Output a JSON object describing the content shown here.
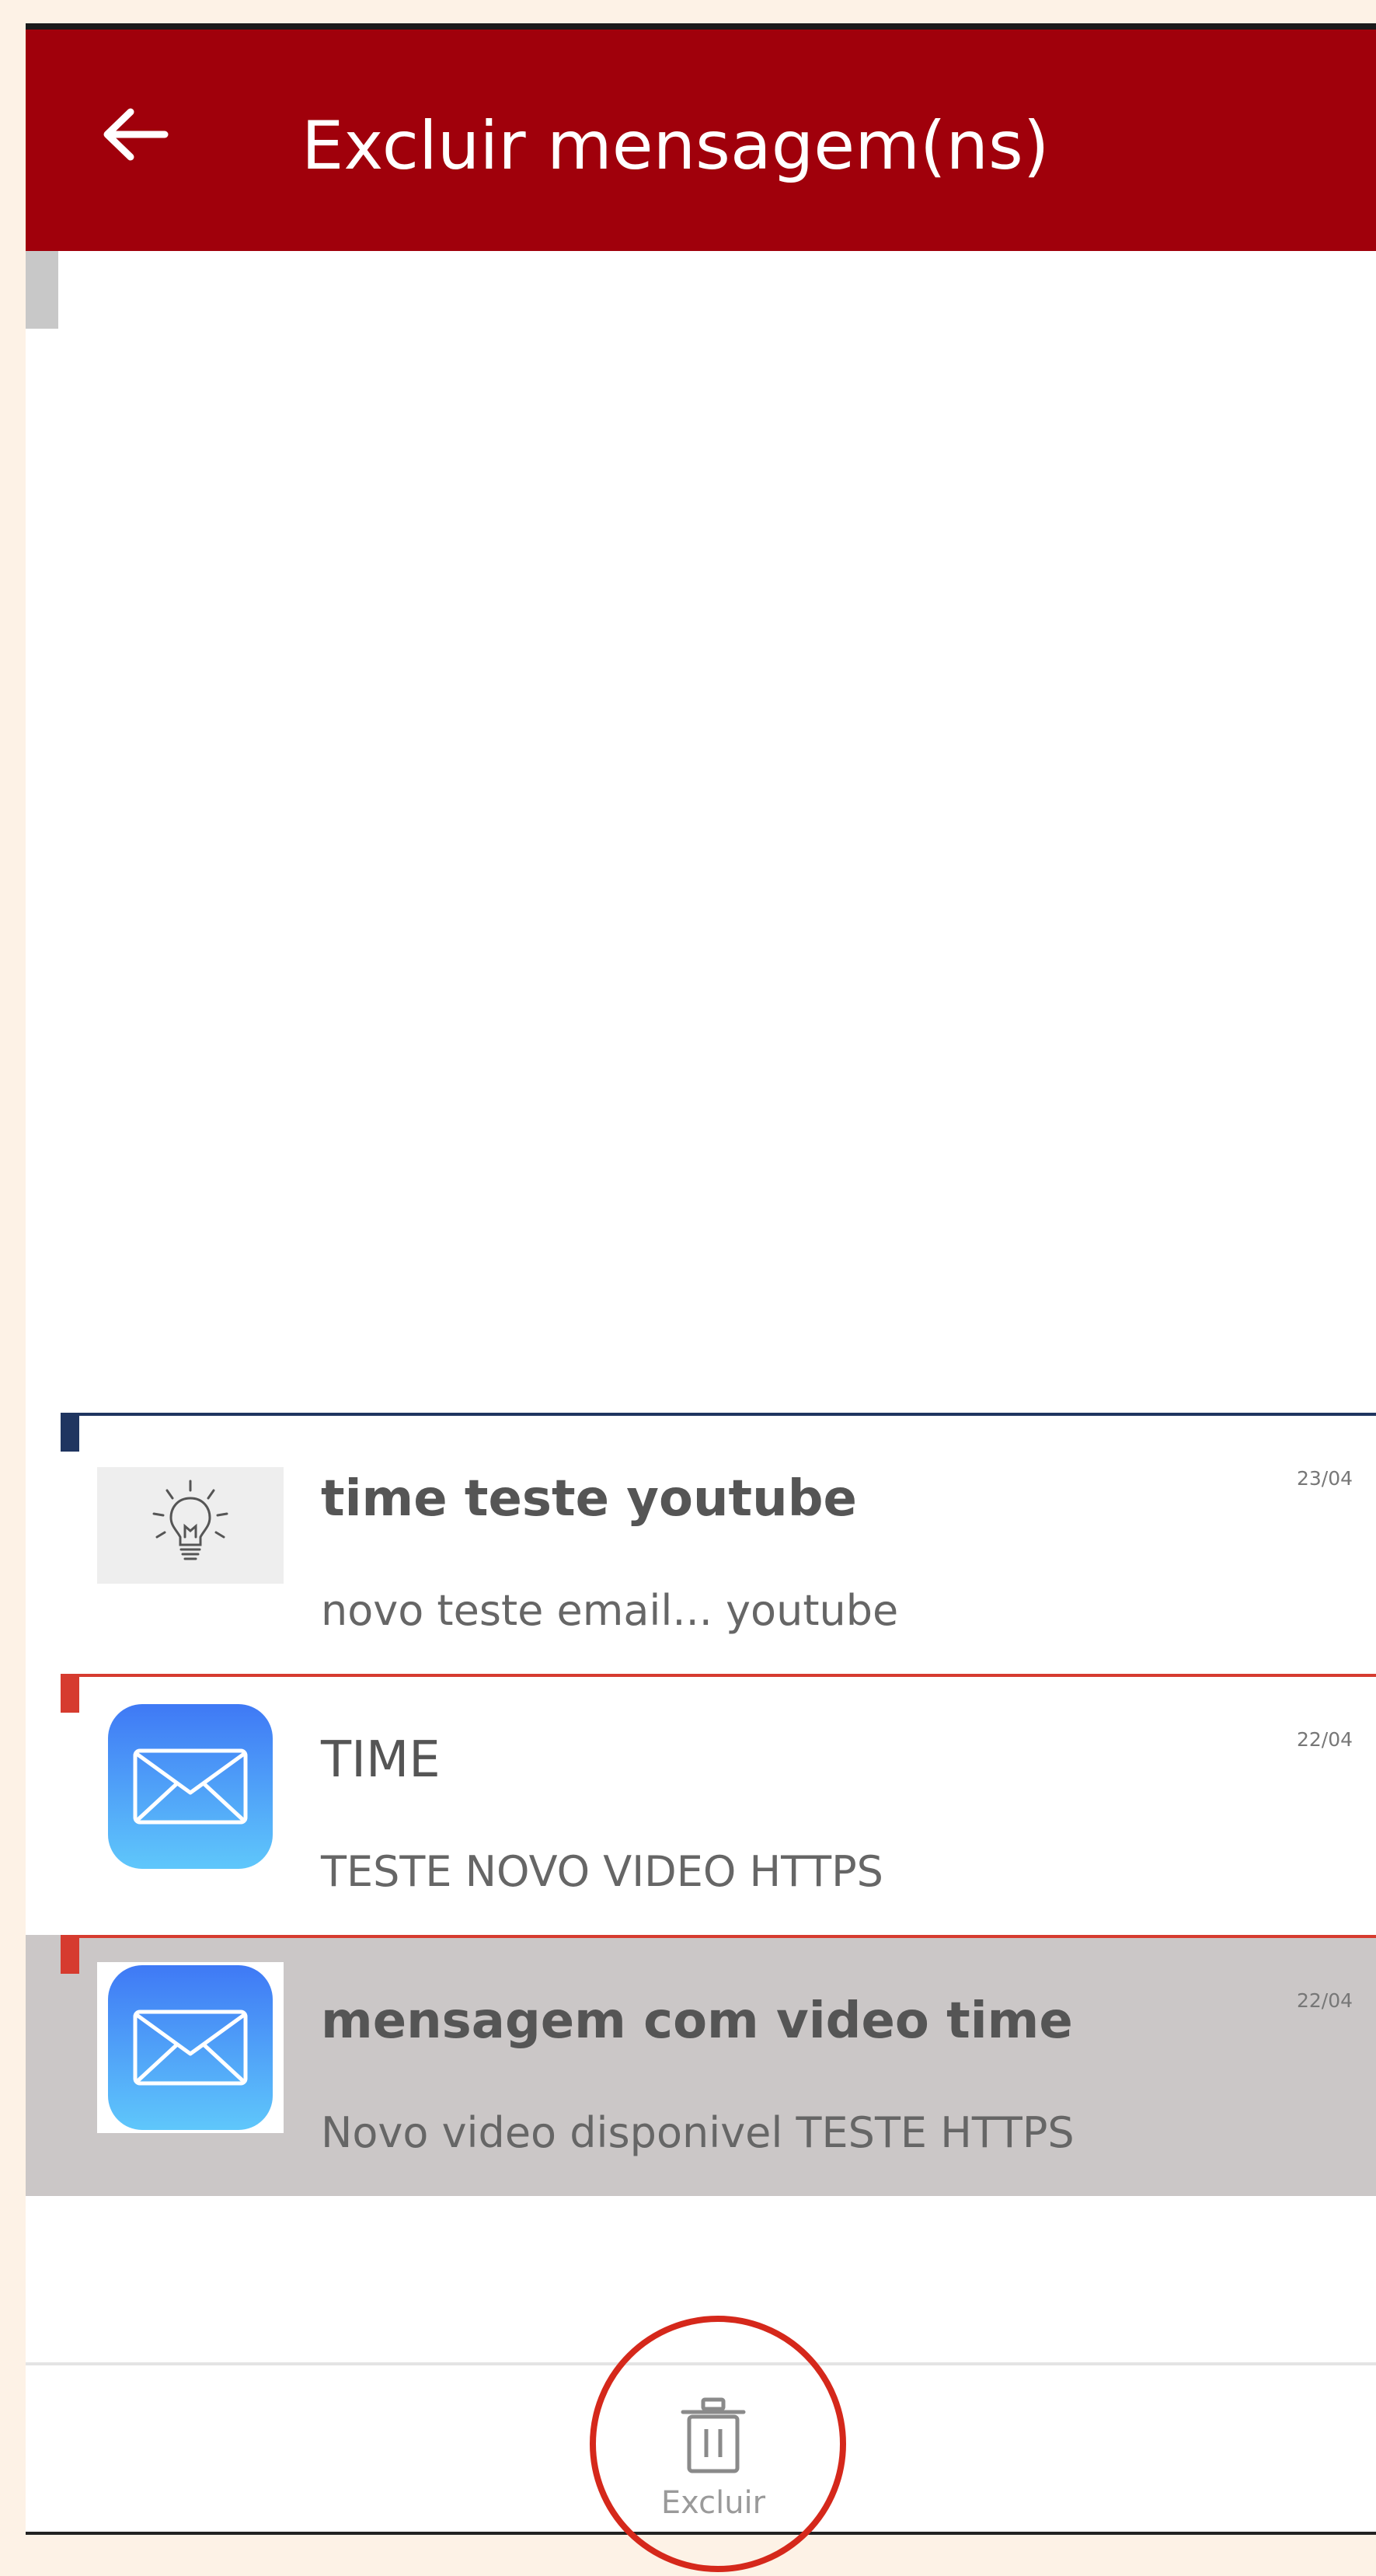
{
  "header": {
    "title": "Excluir mensagem(ns)",
    "background_color": "#a0000b",
    "back_icon": "arrow-left-icon"
  },
  "messages": [
    {
      "title": "time teste youtube",
      "preview": "novo teste email... youtube",
      "date": "23/04",
      "thumbnail_icon": "lightbulb-icon",
      "accent_color": "#1f3560",
      "selected": false
    },
    {
      "title": "TIME",
      "preview": "TESTE NOVO VIDEO HTTPS",
      "date": "22/04",
      "thumbnail_icon": "mail-icon",
      "accent_color": "#d63b2f",
      "selected": false
    },
    {
      "title": "mensagem com video time",
      "preview": "Novo video disponivel TESTE HTTPS",
      "date": "22/04",
      "thumbnail_icon": "mail-icon",
      "accent_color": "#d63b2f",
      "selected": true
    }
  ],
  "bottom_bar": {
    "delete_label": "Excluir",
    "delete_icon": "trash-icon",
    "highlight_color": "#d5281b"
  }
}
